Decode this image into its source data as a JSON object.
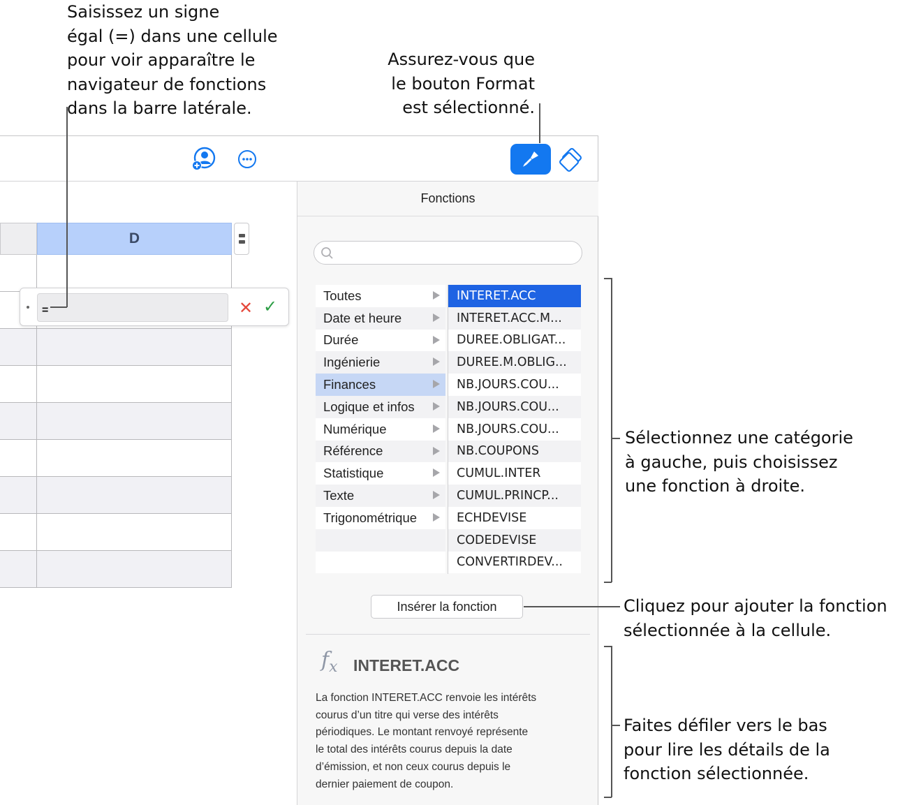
{
  "callouts": {
    "top_left": "Saisissez un signe\négal (=) dans une cellule\npour voir apparaître le\nnavigateur de fonctions\ndans la barre latérale.",
    "top_right": "Assurez-vous que\nle bouton Format\nest sélectionné.",
    "right_1": "Sélectionnez une catégorie\nà gauche, puis choisissez\nune fonction à droite.",
    "right_2": "Cliquez pour ajouter la fonction\nsélectionnée à la cellule.",
    "right_3": "Faites défiler vers le bas\npour lire les détails de la\nfonction sélectionnée."
  },
  "toolbar": {
    "icons": [
      "collaborate-icon",
      "more-icon",
      "format-paintbrush-icon",
      "organize-icon"
    ],
    "accent": "#1378f0"
  },
  "sheet": {
    "column_header": "D",
    "formula_value": "="
  },
  "sidebar": {
    "title": "Fonctions",
    "search_placeholder": "",
    "categories": [
      {
        "label": "Toutes",
        "selected": false
      },
      {
        "label": "Date et heure",
        "selected": false
      },
      {
        "label": "Durée",
        "selected": false
      },
      {
        "label": "Ingénierie",
        "selected": false
      },
      {
        "label": "Finances",
        "selected": true
      },
      {
        "label": "Logique et infos",
        "selected": false
      },
      {
        "label": "Numérique",
        "selected": false
      },
      {
        "label": "Référence",
        "selected": false
      },
      {
        "label": "Statistique",
        "selected": false
      },
      {
        "label": "Texte",
        "selected": false
      },
      {
        "label": "Trigonométrique",
        "selected": false
      }
    ],
    "functions": [
      {
        "label": "INTERET.ACC",
        "selected": true
      },
      {
        "label": "INTERET.ACC.M...",
        "selected": false
      },
      {
        "label": "DUREE.OBLIGAT...",
        "selected": false
      },
      {
        "label": "DUREE.M.OBLIG...",
        "selected": false
      },
      {
        "label": "NB.JOURS.COU...",
        "selected": false
      },
      {
        "label": "NB.JOURS.COU...",
        "selected": false
      },
      {
        "label": "NB.JOURS.COU...",
        "selected": false
      },
      {
        "label": "NB.COUPONS",
        "selected": false
      },
      {
        "label": "CUMUL.INTER",
        "selected": false
      },
      {
        "label": "CUMUL.PRINCP...",
        "selected": false
      },
      {
        "label": "ECHDEVISE",
        "selected": false
      },
      {
        "label": "CODEDEVISE",
        "selected": false
      },
      {
        "label": "CONVERTIRDEV...",
        "selected": false
      }
    ],
    "insert_button": "Insérer la fonction",
    "detail": {
      "name": "INTERET.ACC",
      "description": "La fonction INTERET.ACC renvoie les intérêts\ncourus d’un titre qui verse des intérêts\npériodiques. Le montant renvoyé représente\nle total des intérêts courus depuis la date\nd’émission, et non ceux courus depuis le\ndernier paiement de coupon."
    }
  }
}
